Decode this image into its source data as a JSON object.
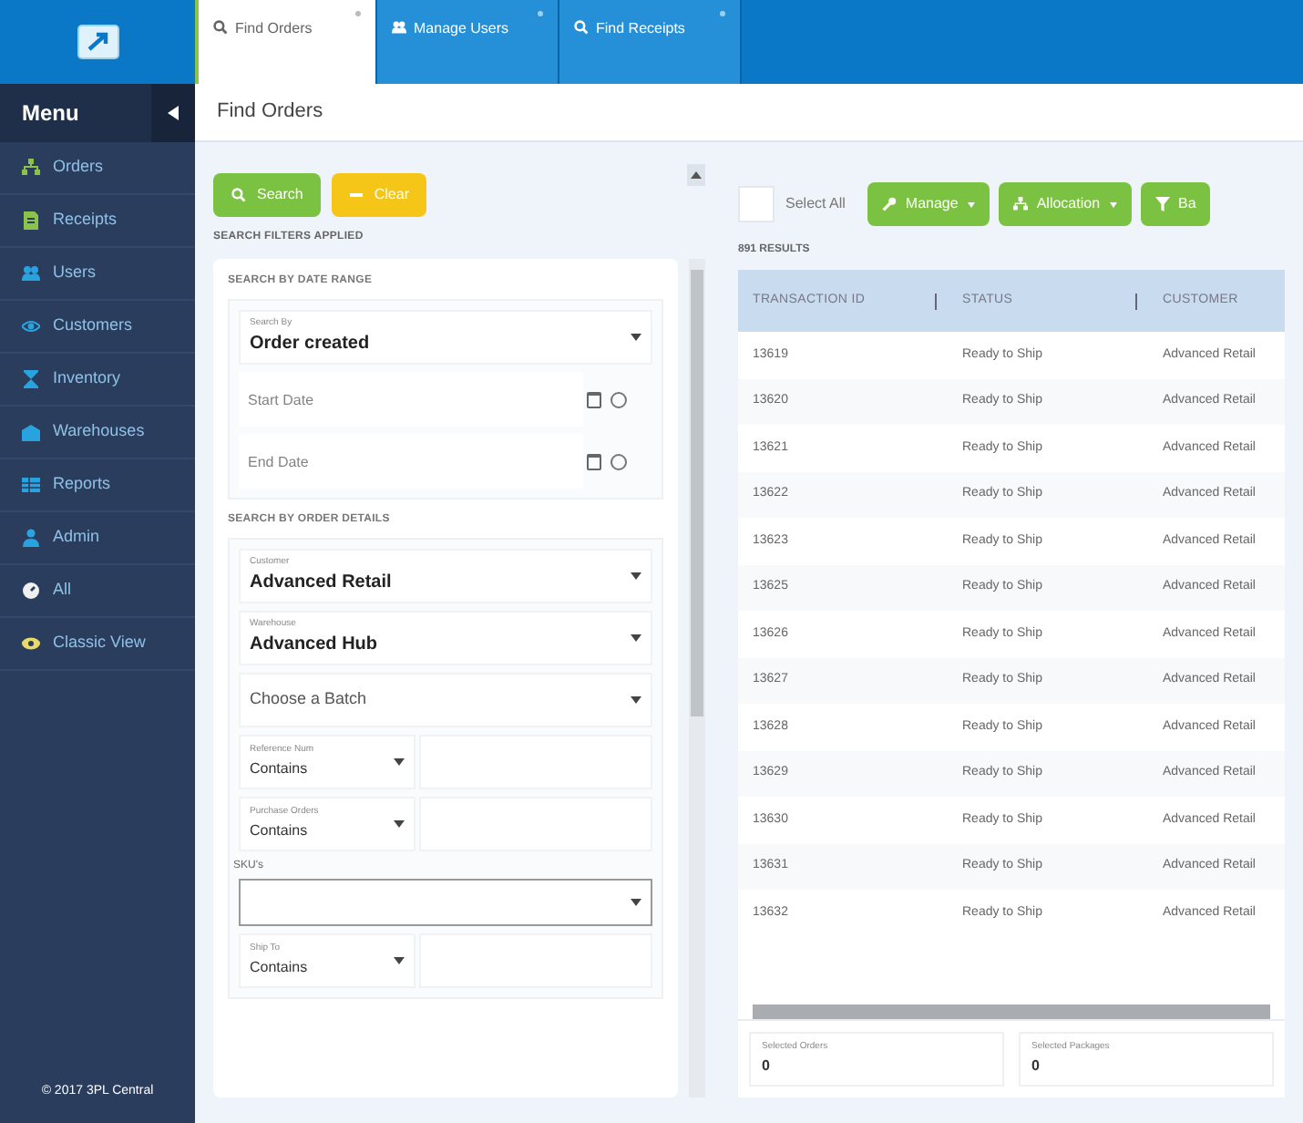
{
  "tabs": [
    {
      "label": "Find Orders",
      "selected": true
    },
    {
      "label": "Manage Users",
      "selected": false
    },
    {
      "label": "Find Receipts",
      "selected": false
    }
  ],
  "sidebar": {
    "title": "Menu",
    "items": [
      {
        "label": "Orders",
        "color": "#8bc34a"
      },
      {
        "label": "Receipts",
        "color": "#8bc34a"
      },
      {
        "label": "Users",
        "color": "#29a3e0"
      },
      {
        "label": "Customers",
        "color": "#29a3e0"
      },
      {
        "label": "Inventory",
        "color": "#29a3e0"
      },
      {
        "label": "Warehouses",
        "color": "#29a3e0"
      },
      {
        "label": "Reports",
        "color": "#29a3e0"
      },
      {
        "label": "Admin",
        "color": "#29a3e0"
      },
      {
        "label": "All",
        "color": "#f0f0f0"
      },
      {
        "label": "Classic View",
        "color": "#e8d96a"
      }
    ],
    "footer": "© 2017 3PL Central"
  },
  "page_title": "Find Orders",
  "filters": {
    "buttons": [
      {
        "label": "Search",
        "kind": "search"
      },
      {
        "label": "Clear",
        "kind": "clear"
      }
    ],
    "applied_label": "SEARCH FILTERS APPLIED",
    "sections": [
      {
        "title": "SEARCH BY DATE RANGE",
        "fields": [
          {
            "kind": "select",
            "label": "Search By",
            "value": "Order created"
          },
          {
            "kind": "date",
            "placeholder": "Start Date"
          },
          {
            "kind": "date",
            "placeholder": "End Date"
          }
        ]
      },
      {
        "title": "SEARCH BY ORDER DETAILS",
        "fields": [
          {
            "kind": "select",
            "label": "Customer",
            "value": "Advanced Retail"
          },
          {
            "kind": "select",
            "label": "Warehouse",
            "value": "Advanced Hub"
          },
          {
            "kind": "select",
            "placeholder": "Choose a Batch"
          },
          {
            "kind": "combo",
            "label": "Reference Num",
            "value": "Contains"
          },
          {
            "kind": "combo",
            "label": "Purchase Orders",
            "value": "Contains"
          },
          {
            "kind": "sku",
            "label": "SKU's"
          },
          {
            "kind": "combo",
            "label": "Ship To",
            "value": "Contains"
          }
        ]
      }
    ]
  },
  "results": {
    "select_all": {
      "label": "Select All",
      "checked": false
    },
    "actions": [
      {
        "label": "Manage"
      },
      {
        "label": "Allocation"
      },
      {
        "label": "Ba"
      }
    ],
    "count": "891 RESULTS",
    "table": {
      "columns": [
        "TRANSACTION ID",
        "STATUS",
        "CUSTOMER"
      ],
      "rows": [
        [
          "13619",
          "Ready to Ship",
          "Advanced Retail"
        ],
        [
          "13620",
          "Ready to Ship",
          "Advanced Retail"
        ],
        [
          "13621",
          "Ready to Ship",
          "Advanced Retail"
        ],
        [
          "13622",
          "Ready to Ship",
          "Advanced Retail"
        ],
        [
          "13623",
          "Ready to Ship",
          "Advanced Retail"
        ],
        [
          "13625",
          "Ready to Ship",
          "Advanced Retail"
        ],
        [
          "13626",
          "Ready to Ship",
          "Advanced Retail"
        ],
        [
          "13627",
          "Ready to Ship",
          "Advanced Retail"
        ],
        [
          "13628",
          "Ready to Ship",
          "Advanced Retail"
        ],
        [
          "13629",
          "Ready to Ship",
          "Advanced Retail"
        ],
        [
          "13630",
          "Ready to Ship",
          "Advanced Retail"
        ],
        [
          "13631",
          "Ready to Ship",
          "Advanced Retail"
        ],
        [
          "13632",
          "Ready to Ship",
          "Advanced Retail"
        ]
      ]
    },
    "totals": [
      {
        "label": "Selected Orders",
        "value": "0"
      },
      {
        "label": "Selected Packages",
        "value": "0"
      }
    ]
  }
}
